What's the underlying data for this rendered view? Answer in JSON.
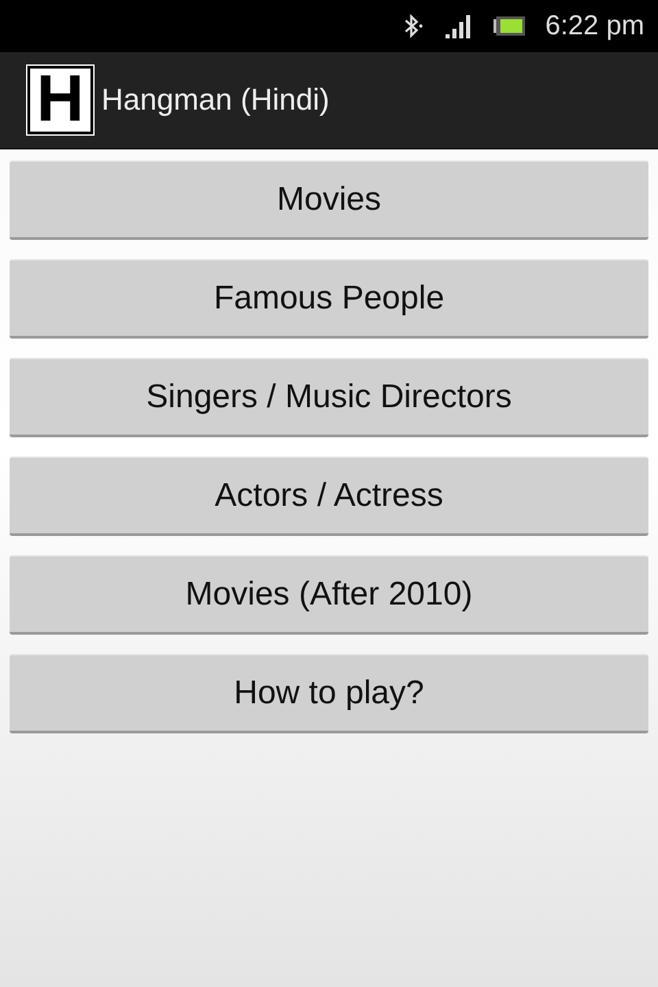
{
  "status_bar": {
    "time": "6:22 pm"
  },
  "action_bar": {
    "logo_letter": "H",
    "title": "Hangman (Hindi)"
  },
  "menu_buttons": [
    {
      "label": "Movies"
    },
    {
      "label": "Famous People"
    },
    {
      "label": "Singers / Music Directors"
    },
    {
      "label": "Actors / Actress"
    },
    {
      "label": "Movies (After 2010)"
    },
    {
      "label": "How to play?"
    }
  ]
}
